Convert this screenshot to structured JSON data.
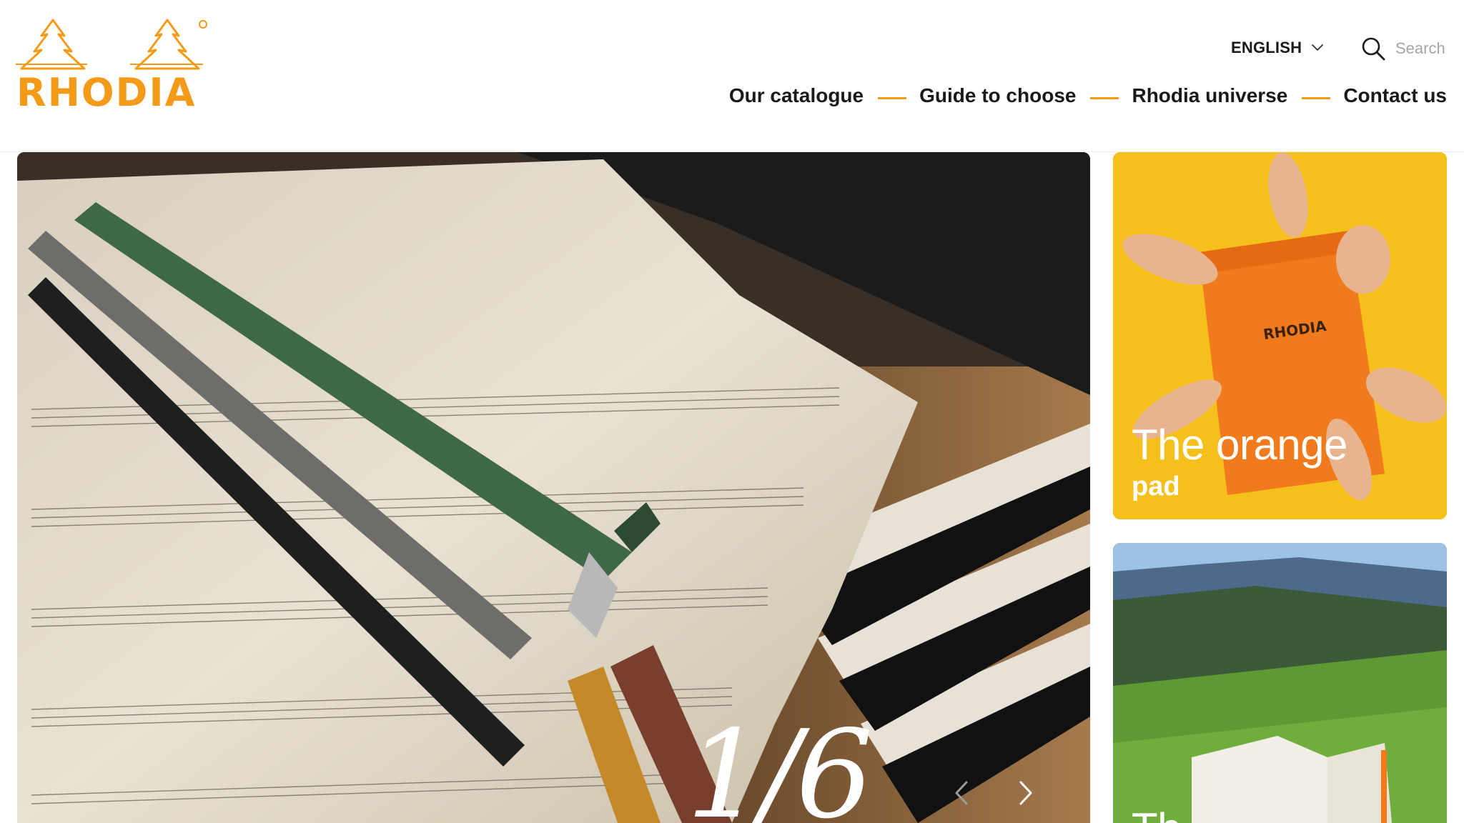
{
  "brand": {
    "name": "RHODIA",
    "accent_color": "#f39b18"
  },
  "header": {
    "language": {
      "label": "ENGLISH",
      "icon": "chevron-down-icon"
    },
    "search": {
      "placeholder": "Search",
      "icon": "search-icon"
    },
    "nav": [
      {
        "label": "Our catalogue"
      },
      {
        "label": "Guide to choose"
      },
      {
        "label": "Rhodia universe"
      },
      {
        "label": "Contact us"
      }
    ]
  },
  "hero": {
    "slide_counter": "1/6",
    "prev_icon": "chevron-left-icon",
    "next_icon": "chevron-right-icon"
  },
  "cards": [
    {
      "title_light": "The orange",
      "title_bold": "pad",
      "background": "#f6c21a"
    },
    {
      "title_light": "Th",
      "title_bold": "",
      "background": "#6c9a3e"
    }
  ]
}
